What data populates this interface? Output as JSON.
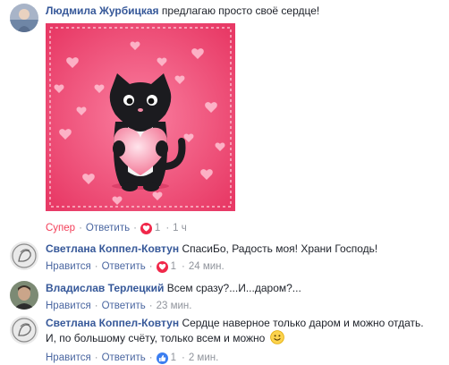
{
  "comments": [
    {
      "author": "Людмила Журбицкая",
      "text": "предлагаю просто своё сердце!",
      "reaction_label": "Супер",
      "reply_label": "Ответить",
      "reaction_icon": "heart-icon",
      "reaction_count": "1",
      "time": "1 ч"
    },
    {
      "author": "Светлана Коппел-Ковтун",
      "text": "СпасиБо, Радость моя! Храни Господь!",
      "reaction_label": "Нравится",
      "reply_label": "Ответить",
      "reaction_icon": "heart-icon",
      "reaction_count": "1",
      "time": "24 мин."
    },
    {
      "author": "Владислав Терлецкий",
      "text": "Всем сразу?...И...даром?...",
      "reaction_label": "Нравится",
      "reply_label": "Ответить",
      "time": "23 мин."
    },
    {
      "author": "Светлана Коппел-Ковтун",
      "text_line1": "Сердце наверное только даром и можно отдать.",
      "text_line2": "И, по большому счёту, только всем и можно",
      "reaction_label": "Нравится",
      "reply_label": "Ответить",
      "reaction_icon": "like-icon",
      "reaction_count": "1",
      "time": "2 мин."
    }
  ],
  "colors": {
    "author": "#365899",
    "link": "#4b67a1",
    "meta": "#90949c",
    "reacted": "#f33e58",
    "love": "#f0284a",
    "like": "#3b7ef0",
    "card_pink": "#f0507a"
  }
}
